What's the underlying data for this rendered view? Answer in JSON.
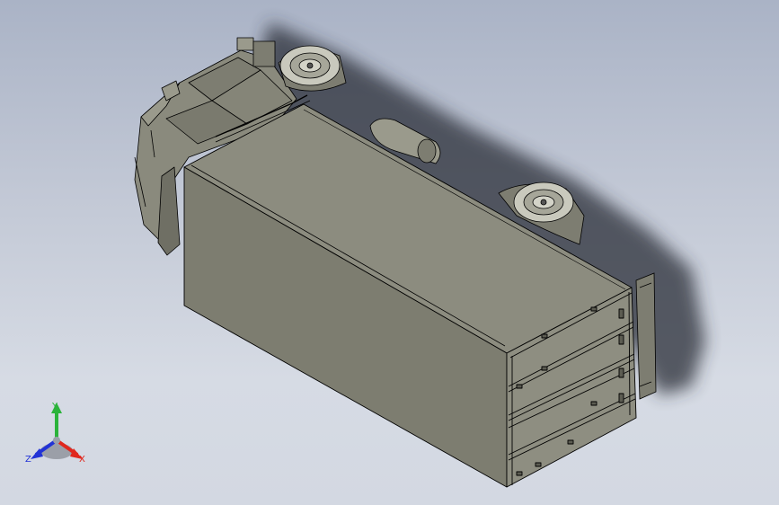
{
  "viewport": {
    "background_top": "#aab3c6",
    "background_bottom": "#d3d8e2"
  },
  "model": {
    "part_color": "#8a8a7d",
    "edge_color": "#000000",
    "shadow_color": "#2a2e38"
  },
  "triad": {
    "x_label": "X",
    "y_label": "Y",
    "z_label": "Z",
    "x_color": "#e0281e",
    "y_color": "#2bb33a",
    "z_color": "#2233d6"
  }
}
